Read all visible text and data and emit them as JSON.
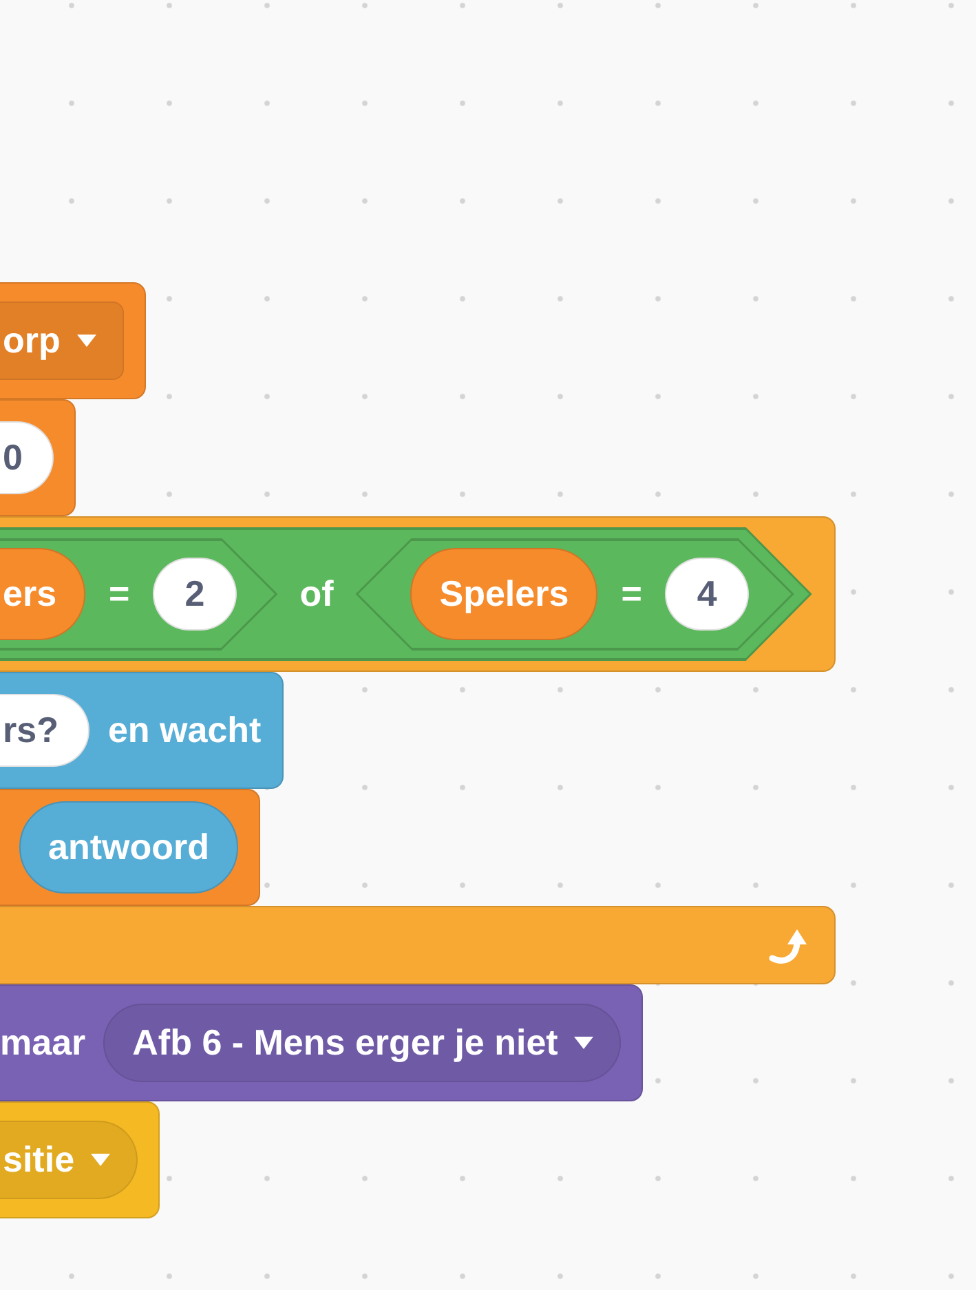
{
  "workspace": {
    "blocks": [
      {
        "kind": "command",
        "color": "#f68b2c",
        "items": [
          {
            "kind": "square_dropdown",
            "text": "orp"
          }
        ]
      },
      {
        "kind": "command",
        "color": "#f68b2c",
        "items": [
          {
            "kind": "input",
            "text": "0"
          }
        ]
      },
      {
        "kind": "c_top",
        "color": "#f8a933",
        "items": [
          {
            "kind": "boolean",
            "color": "#5cb85c",
            "items": [
              {
                "kind": "boolean",
                "items": [
                  {
                    "kind": "reporter",
                    "color": "#f68b2c",
                    "text": "ers"
                  },
                  {
                    "kind": "label",
                    "text": "="
                  },
                  {
                    "kind": "input",
                    "text": "2"
                  }
                ]
              },
              {
                "kind": "label",
                "text": "of"
              },
              {
                "kind": "boolean",
                "items": [
                  {
                    "kind": "reporter",
                    "color": "#f68b2c",
                    "text": "Spelers"
                  },
                  {
                    "kind": "label",
                    "text": "="
                  },
                  {
                    "kind": "input",
                    "text": "4"
                  }
                ]
              }
            ]
          }
        ]
      },
      {
        "kind": "command",
        "color": "#56add6",
        "items": [
          {
            "kind": "input",
            "text": "rs?"
          },
          {
            "kind": "label",
            "text": "en wacht"
          }
        ]
      },
      {
        "kind": "command",
        "color": "#f68b2c",
        "items": [
          {
            "kind": "reporter",
            "color": "#56add6",
            "text": "antwoord"
          }
        ]
      },
      {
        "kind": "loop_end",
        "color": "#f8a933"
      },
      {
        "kind": "command",
        "color": "#7962b4",
        "items": [
          {
            "kind": "label",
            "text": "maar"
          },
          {
            "kind": "round_dropdown",
            "text": "Afb 6 - Mens erger je niet"
          }
        ]
      },
      {
        "kind": "command",
        "color": "#f5b923",
        "items": [
          {
            "kind": "round_dropdown",
            "text": "sitie"
          }
        ]
      }
    ]
  }
}
